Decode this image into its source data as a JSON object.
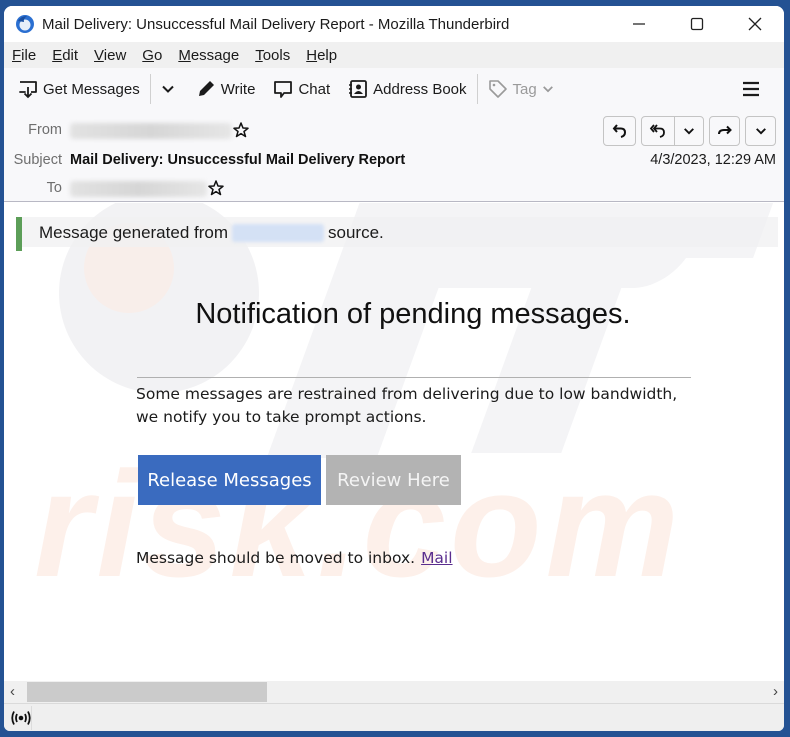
{
  "window": {
    "title": "Mail Delivery: Unsuccessful Mail Delivery Report - Mozilla Thunderbird",
    "controls": {
      "minimize": "minimize-icon",
      "maximize": "maximize-icon",
      "close": "close-icon"
    }
  },
  "menubar": {
    "items": [
      {
        "label": "File",
        "accel": "F",
        "rest": "ile"
      },
      {
        "label": "Edit",
        "accel": "E",
        "rest": "dit"
      },
      {
        "label": "View",
        "accel": "V",
        "rest": "iew"
      },
      {
        "label": "Go",
        "accel": "G",
        "rest": "o"
      },
      {
        "label": "Message",
        "accel": "M",
        "rest": "essage"
      },
      {
        "label": "Tools",
        "accel": "T",
        "rest": "ools"
      },
      {
        "label": "Help",
        "accel": "H",
        "rest": "elp"
      }
    ]
  },
  "toolbar": {
    "get_messages": "Get Messages",
    "write": "Write",
    "chat": "Chat",
    "address_book": "Address Book",
    "tag": "Tag"
  },
  "header": {
    "from_label": "From",
    "subject_label": "Subject",
    "to_label": "To",
    "subject": "Mail Delivery: Unsuccessful Mail Delivery Report",
    "date": "4/3/2023, 12:29 AM"
  },
  "body": {
    "notice_prefix": "Message generated from",
    "notice_suffix": "source.",
    "headline": "Notification of pending messages.",
    "paragraph": "Some messages are restrained from delivering due to low bandwidth, we notify you to take prompt actions.",
    "release_button": "Release Messages",
    "review_button": "Review Here",
    "footer_text": "Message should be moved to inbox.",
    "footer_link": "Mail",
    "colors": {
      "release": "#3a6bbf",
      "review": "#b3b3b3",
      "link": "#5a2d8e",
      "notice_bar": "#5c9e58"
    }
  },
  "scrollbar": {
    "left_arrow": "‹",
    "right_arrow": "›"
  }
}
